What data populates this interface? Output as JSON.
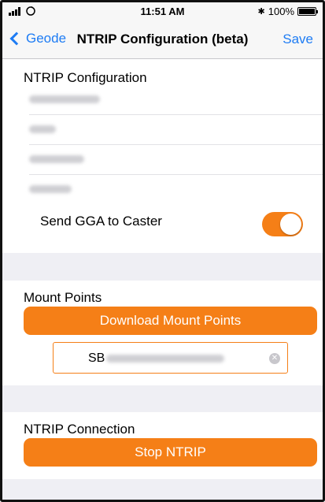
{
  "status_bar": {
    "signal_icon": "cellular-signal-icon",
    "rotation_icon": "rotation-lock-icon",
    "time": "11:51 AM",
    "bluetooth_glyph": "✱",
    "battery": "100%",
    "battery_level": 1.0
  },
  "navbar": {
    "back_label": "Geode",
    "title": "NTRIP Configuration (beta)",
    "save_label": "Save"
  },
  "ntrip_config": {
    "title": "NTRIP Configuration",
    "send_gga_label": "Send GGA to Caster",
    "send_gga_on": true
  },
  "mount_points": {
    "title": "Mount Points",
    "download_button": "Download Mount Points",
    "selected_prefix": "SB",
    "clear_glyph": "✕"
  },
  "ntrip_connection": {
    "title": "NTRIP Connection",
    "stop_button": "Stop NTRIP"
  },
  "colors": {
    "accent": "#f57f17",
    "link": "#1e7cf4",
    "grouped_background": "#efeff4"
  }
}
